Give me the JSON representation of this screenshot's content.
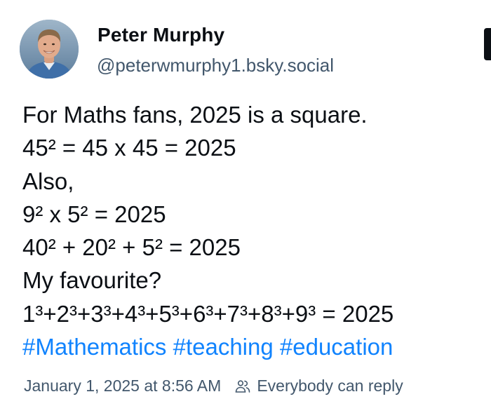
{
  "author": {
    "display_name": "Peter Murphy",
    "handle": "@peterwmurphy1.bsky.social",
    "avatar_icon": "user-avatar"
  },
  "post": {
    "lines": [
      "For Maths fans, 2025 is a square.",
      "45² = 45 x 45 = 2025",
      "Also,",
      "9² x 5² = 2025",
      "40² + 20² + 5² = 2025",
      "My favourite?",
      "1³+2³+3³+4³+5³+6³+7³+8³+9³ = 2025"
    ],
    "hashtags": [
      "#Mathematics",
      "#teaching",
      "#education"
    ]
  },
  "meta": {
    "timestamp": "January 1, 2025 at 8:56 AM",
    "reply_setting": "Everybody can reply",
    "reply_icon": "people-icon"
  },
  "colors": {
    "text": "#0b0f14",
    "secondary": "#42576c",
    "link": "#1083fe"
  }
}
